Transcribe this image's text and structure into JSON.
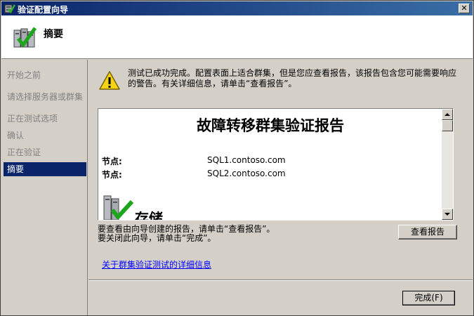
{
  "window": {
    "title": "验证配置向导",
    "close_label": "✕"
  },
  "header": {
    "title": "摘要"
  },
  "sidebar": {
    "steps": [
      {
        "label": "开始之前"
      },
      {
        "label": "请选择服务器或群集"
      },
      {
        "label": "正在测试选项"
      },
      {
        "label": "确认"
      },
      {
        "label": "正在验证"
      },
      {
        "label": "摘要"
      }
    ]
  },
  "content": {
    "warning_text": "测试已成功完成。配置表面上适合群集，但是您应查看报告，该报告包含您可能需要响应的警告。有关详细信息，请单击“查看报告”。",
    "report": {
      "title": "故障转移群集验证报告",
      "nodes": [
        {
          "label": "节点:",
          "value": "SQL1.contoso.com"
        },
        {
          "label": "节点:",
          "value": "SQL2.contoso.com"
        }
      ],
      "section_title": "存储"
    },
    "info_line1": "要查看由向导创建的报告，请单击“查看报告”。",
    "info_line2": "要关闭此向导，请单击“完成”。",
    "view_report_button": "查看报告",
    "details_link": "关于群集验证测试的详细信息",
    "finish_button": "完成(F)"
  }
}
